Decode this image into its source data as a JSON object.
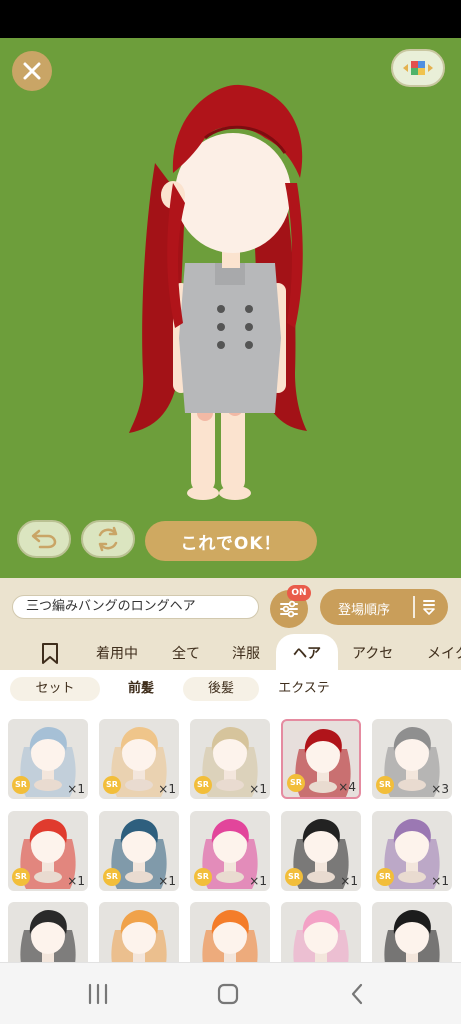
{
  "stage": {
    "ok_label": "これでOK！",
    "colors": {
      "background": "#6d9e3b",
      "button_gold": "#cfa961",
      "hair": "#b0141a"
    }
  },
  "search": {
    "name_value": "三つ編みバングのロングヘア",
    "filter_badge": "ON",
    "sort_label": "登場順序"
  },
  "tabs": {
    "items": [
      "着用中",
      "全て",
      "洋服",
      "ヘア",
      "アクセ",
      "メイク"
    ],
    "active": "ヘア"
  },
  "subtabs": {
    "items": [
      "セット",
      "前髪",
      "後髪",
      "エクステ"
    ],
    "active": "前髪"
  },
  "items": [
    {
      "name": "light-blue-hair-item",
      "rarity": "SR",
      "count": "×1",
      "hair": "#a6c0d6",
      "selected": false
    },
    {
      "name": "blonde-bob-hair-item",
      "rarity": "SR",
      "count": "×1",
      "hair": "#efc58a",
      "selected": false
    },
    {
      "name": "wavy-blonde-hair-item",
      "rarity": "SR",
      "count": "×1",
      "hair": "#d6c49c",
      "selected": false
    },
    {
      "name": "red-long-hair-item",
      "rarity": "SR",
      "count": "×4",
      "hair": "#b0141a",
      "selected": true
    },
    {
      "name": "gray-hair-item",
      "rarity": "SR",
      "count": "×3",
      "hair": "#8f8f8f",
      "selected": false
    },
    {
      "name": "red-curly-hair-item",
      "rarity": "SR",
      "count": "×1",
      "hair": "#e03b2e",
      "selected": false
    },
    {
      "name": "teal-bob-hair-item",
      "rarity": "SR",
      "count": "×1",
      "hair": "#2e5f7e",
      "selected": false
    },
    {
      "name": "pink-spiky-hair-item",
      "rarity": "SR",
      "count": "×1",
      "hair": "#e2459b",
      "selected": false
    },
    {
      "name": "black-twintail-hair-item",
      "rarity": "SR",
      "count": "×1",
      "hair": "#222222",
      "selected": false
    },
    {
      "name": "purple-long-hair-item",
      "rarity": "SR",
      "count": "×1",
      "hair": "#9b78b3",
      "selected": false
    },
    {
      "name": "black-twintail-2-hair-item",
      "rarity": "",
      "count": "",
      "hair": "#2a2a2a",
      "selected": false
    },
    {
      "name": "orange-twintail-hair-item",
      "rarity": "",
      "count": "",
      "hair": "#f0a24a",
      "selected": false
    },
    {
      "name": "orange-bun-hair-item",
      "rarity": "",
      "count": "",
      "hair": "#f47d2a",
      "selected": false
    },
    {
      "name": "pink-short-hair-item",
      "rarity": "",
      "count": "",
      "hair": "#f3a2c6",
      "selected": false
    },
    {
      "name": "black-short-hair-item",
      "rarity": "",
      "count": "",
      "hair": "#1c1c1c",
      "selected": false
    }
  ]
}
